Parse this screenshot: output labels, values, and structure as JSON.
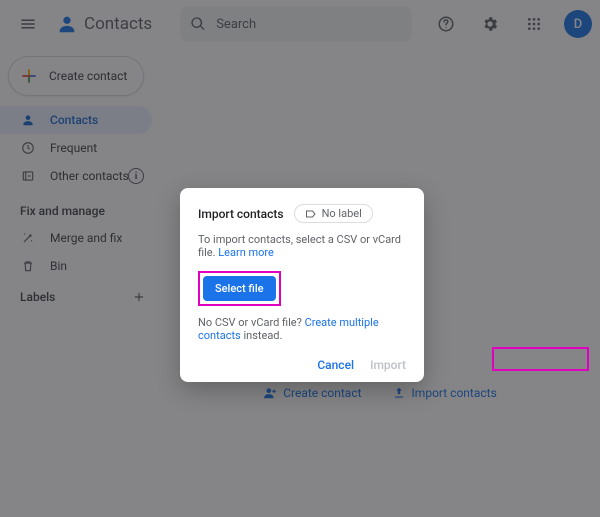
{
  "header": {
    "app_name": "Contacts",
    "search_placeholder": "Search",
    "avatar_letter": "D"
  },
  "sidebar": {
    "create_label": "Create contact",
    "nav": [
      {
        "icon": "person",
        "label": "Contacts",
        "active": true
      },
      {
        "icon": "clock",
        "label": "Frequent"
      },
      {
        "icon": "archive",
        "label": "Other contacts",
        "info": true
      }
    ],
    "fix_section": "Fix and manage",
    "fix_items": [
      {
        "icon": "wand",
        "label": "Merge and fix"
      },
      {
        "icon": "trash",
        "label": "Bin"
      }
    ],
    "labels_title": "Labels"
  },
  "bottom": {
    "create": "Create contact",
    "import": "Import contacts"
  },
  "dialog": {
    "title": "Import contacts",
    "chip": "No label",
    "desc_prefix": "To import contacts, select a CSV or vCard file. ",
    "learn_more": "Learn more",
    "select_file": "Select file",
    "alt_prefix": "No CSV or vCard file? ",
    "alt_link": "Create multiple contacts",
    "alt_suffix": " instead.",
    "cancel": "Cancel",
    "import": "Import"
  }
}
